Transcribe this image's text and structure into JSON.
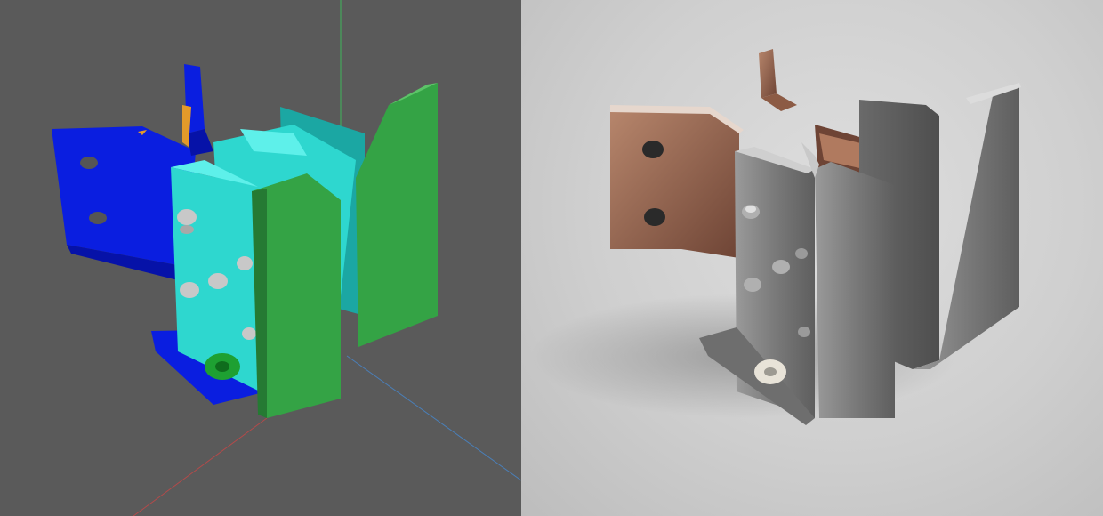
{
  "scene": {
    "left_view": {
      "mode": "viewport-preview",
      "background_color": "#5a5a5a",
      "colors": {
        "blue_part": "#0a1ee0",
        "blue_dark": "#0612a8",
        "cyan_part": "#2ed7cf",
        "cyan_dark": "#1ba7a3",
        "green_part": "#34a345",
        "green_dark": "#257a33",
        "orange_accent": "#e39a2a",
        "bolt": "#c8c8c8",
        "axis_green": "#3fb65a",
        "axis_red": "#b34a4a",
        "axis_blue": "#4a7fb8"
      }
    },
    "right_view": {
      "mode": "photoreal-render",
      "background_color": "#d3d3d3",
      "colors": {
        "copper": "#8a5a44",
        "copper_light": "#b7866c",
        "steel": "#8f8f8f",
        "steel_dark": "#5f5f5f",
        "steel_light": "#c9c9c9",
        "washer": "#e8e3d8"
      }
    }
  }
}
